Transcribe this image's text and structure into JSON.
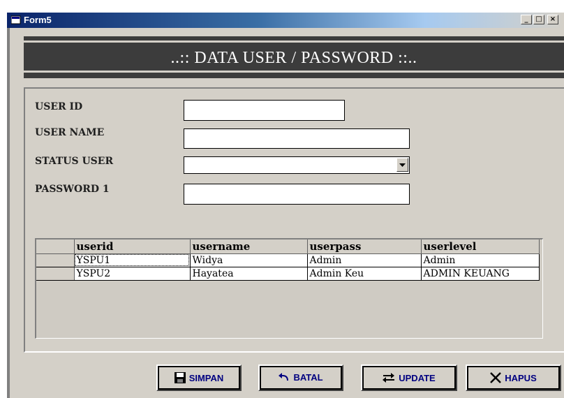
{
  "window": {
    "title": "Form5",
    "minimize_label": "_",
    "maximize_label": "□",
    "close_label": "×"
  },
  "banner": {
    "heading": "..:: DATA USER / PASSWORD ::.."
  },
  "form": {
    "fields": [
      {
        "label": "USER ID",
        "value": ""
      },
      {
        "label": "USER NAME",
        "value": ""
      },
      {
        "label": "STATUS USER",
        "value": ""
      },
      {
        "label": "PASSWORD 1",
        "value": ""
      }
    ]
  },
  "grid": {
    "columns": [
      "userid",
      "username",
      "userpass",
      "userlevel"
    ],
    "rows": [
      [
        "YSPU1",
        "Widya",
        "Admin",
        "Admin"
      ],
      [
        "YSPU2",
        "Hayatea",
        "Admin Keu",
        "ADMIN KEUANG"
      ]
    ]
  },
  "buttons": {
    "save": "SIMPAN",
    "cancel": "BATAL",
    "update": "UPDATE",
    "delete": "HAPUS"
  },
  "colors": {
    "button_text": "#000080",
    "banner_bg": "#3c3c3c",
    "window_bg": "#d4d0c8"
  }
}
